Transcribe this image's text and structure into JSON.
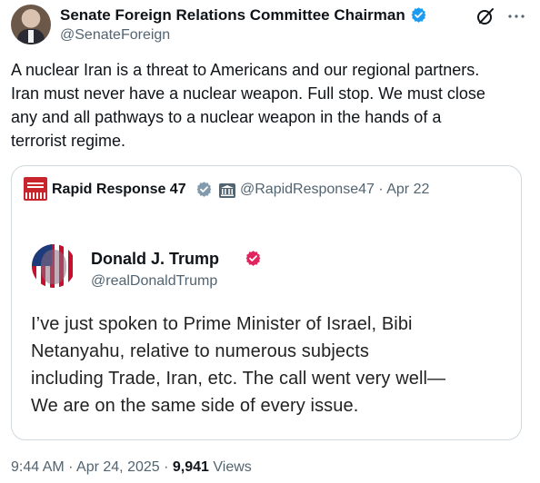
{
  "author": {
    "name": "Senate Foreign Relations Committee Chairman",
    "handle": "@SenateForeign",
    "verified_color": "#1d9bf0"
  },
  "icons": [
    "grok-icon",
    "more-icon"
  ],
  "tweet": {
    "lines": [
      "A nuclear Iran is a threat to Americans and our regional partners.",
      "Iran must never have a nuclear weapon. Full stop. We must close",
      "any and all pathways to a nuclear weapon in the hands of a",
      "terrorist regime."
    ]
  },
  "quote": {
    "name": "Rapid Response 47",
    "handle_date": "@RapidResponse47 · Apr 22",
    "verified_color": "#829aab",
    "embed": {
      "name": "Donald J. Trump",
      "handle": "@realDonaldTrump",
      "verified_color": "#e0245e",
      "lines": [
        "I’ve just spoken to Prime Minister of Israel, Bibi",
        "Netanyahu, relative to numerous subjects",
        "including Trade, Iran, etc. The call went very well—",
        "We are on the same side of every issue."
      ]
    }
  },
  "meta": {
    "timestamp": "9:44 AM · Apr 24, 2025 · ",
    "views_count": "9,941",
    "views_label": " Views"
  }
}
